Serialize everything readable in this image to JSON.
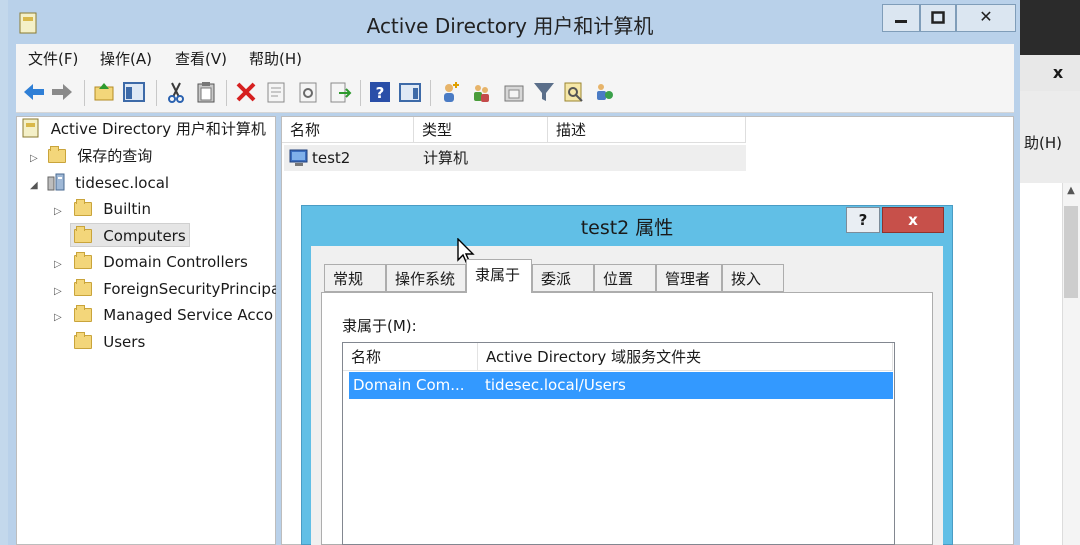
{
  "window": {
    "title": "Active Directory 用户和计算机"
  },
  "menu": [
    "文件(F)",
    "操作(A)",
    "查看(V)",
    "帮助(H)"
  ],
  "tree": {
    "root": "Active Directory 用户和计算机",
    "saved_queries": "保存的查询",
    "domain": "tidesec.local",
    "children": [
      "Builtin",
      "Computers",
      "Domain Controllers",
      "ForeignSecurityPrincipa",
      "Managed Service Acco",
      "Users"
    ]
  },
  "list": {
    "columns": [
      "名称",
      "类型",
      "描述"
    ],
    "rows": [
      {
        "name": "test2",
        "type": "计算机",
        "desc": ""
      }
    ]
  },
  "dialog": {
    "title": "test2 属性",
    "help": "?",
    "close": "x",
    "tabs": [
      "常规",
      "操作系统",
      "隶属于",
      "委派",
      "位置",
      "管理者",
      "拨入"
    ],
    "member_label": "隶属于(M):",
    "member_columns": [
      "名称",
      "Active Directory 域服务文件夹"
    ],
    "members": [
      {
        "name": "Domain Com...",
        "folder": "tidesec.local/Users"
      }
    ]
  },
  "background_window": {
    "close": "x",
    "menu_fragment": "助(H)"
  },
  "colors": {
    "title_bar": "#b9d1ea",
    "dialog_title": "#61bfe6",
    "selection": "#3399ff",
    "close_button": "#c7504a"
  }
}
